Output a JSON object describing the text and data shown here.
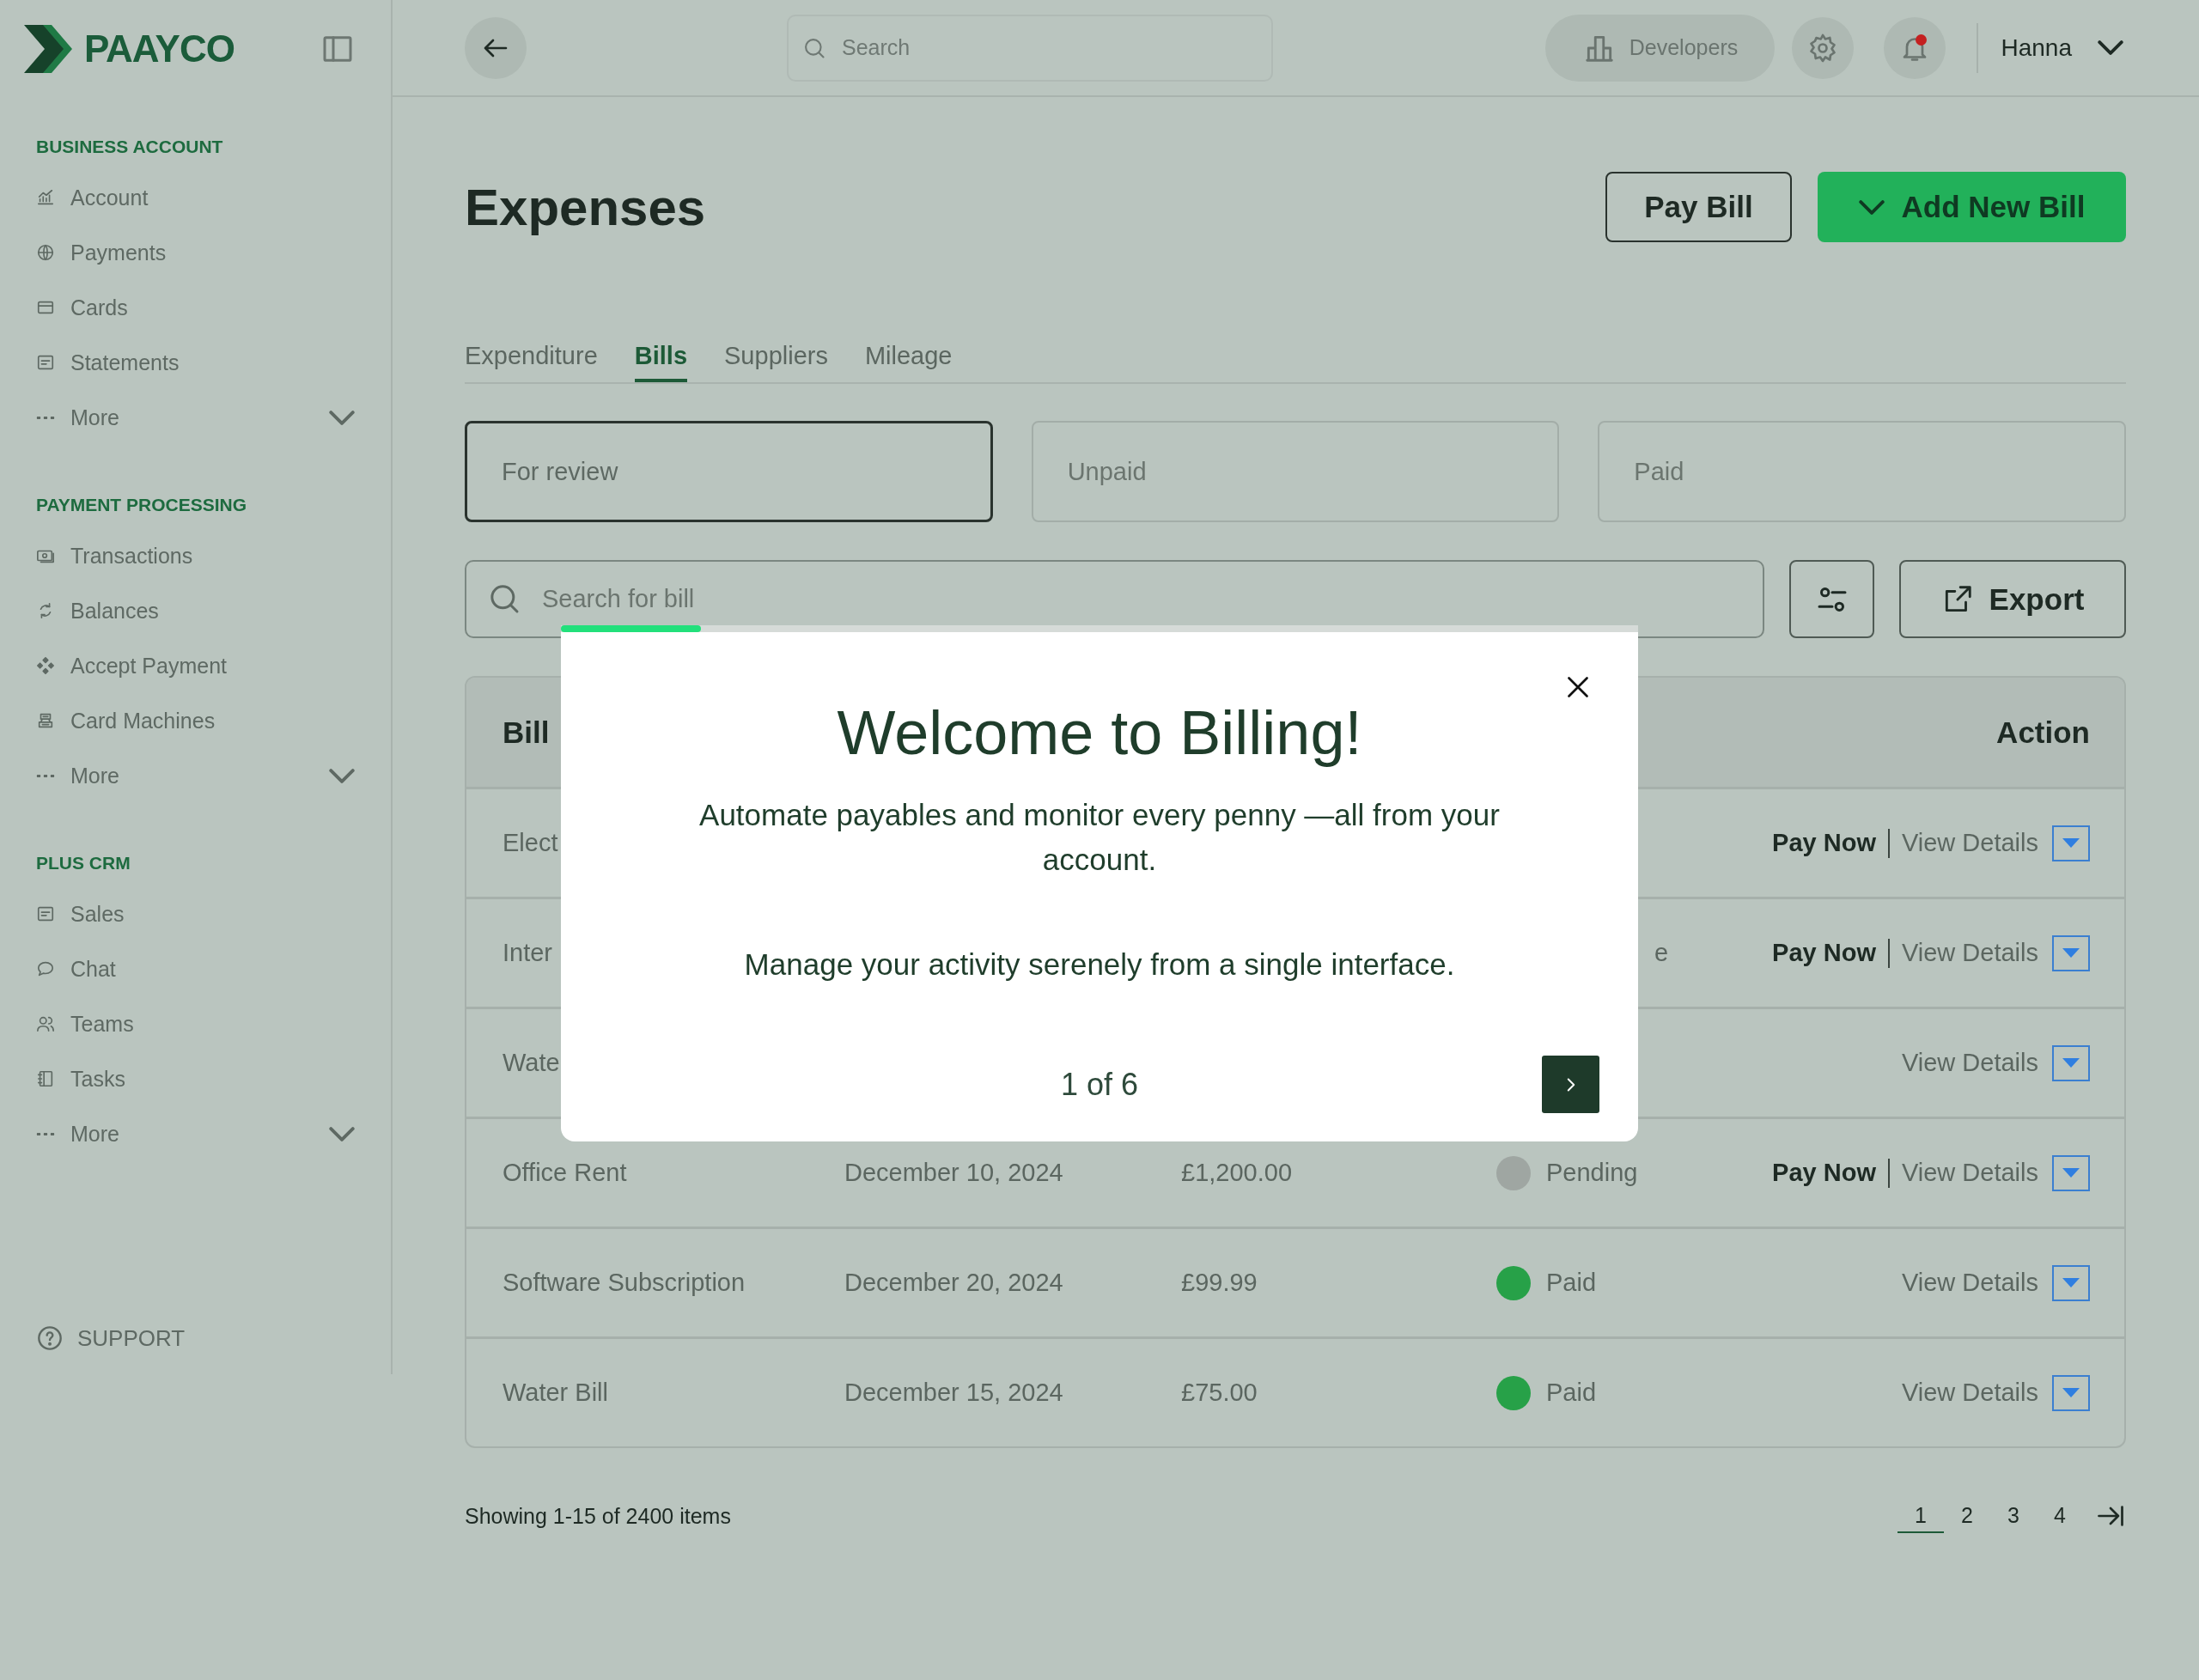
{
  "brand": {
    "name": "PAAYCO"
  },
  "sidebar": {
    "sections": [
      {
        "title": "BUSINESS ACCOUNT",
        "items": [
          {
            "label": "Account",
            "kind": "link"
          },
          {
            "label": "Payments",
            "kind": "link"
          },
          {
            "label": "Cards",
            "kind": "link"
          },
          {
            "label": "Statements",
            "kind": "link"
          },
          {
            "label": "More",
            "kind": "more"
          }
        ]
      },
      {
        "title": "PAYMENT PROCESSING",
        "items": [
          {
            "label": "Transactions",
            "kind": "link"
          },
          {
            "label": "Balances",
            "kind": "link"
          },
          {
            "label": "Accept Payment",
            "kind": "link"
          },
          {
            "label": "Card Machines",
            "kind": "link"
          },
          {
            "label": "More",
            "kind": "more"
          }
        ]
      },
      {
        "title": "PLUS CRM",
        "items": [
          {
            "label": "Sales",
            "kind": "link"
          },
          {
            "label": "Chat",
            "kind": "link"
          },
          {
            "label": "Teams",
            "kind": "link"
          },
          {
            "label": "Tasks",
            "kind": "link"
          },
          {
            "label": "More",
            "kind": "more"
          }
        ]
      }
    ],
    "support": "SUPPORT"
  },
  "topbar": {
    "search": {
      "placeholder": "Search"
    },
    "developers": "Developers",
    "notification": {
      "has_unread": true
    },
    "user": "Hanna"
  },
  "page": {
    "title": "Expenses",
    "buttons": [
      {
        "label": "Pay Bill",
        "kind": "outline"
      },
      {
        "label": "Add New Bill",
        "kind": "primary"
      }
    ]
  },
  "tabs": [
    {
      "label": "Expenditure",
      "selected": false
    },
    {
      "label": "Bills",
      "selected": true
    },
    {
      "label": "Suppliers",
      "selected": false
    },
    {
      "label": "Mileage",
      "selected": false
    }
  ],
  "filters": [
    {
      "label": "For review",
      "selected": true
    },
    {
      "label": "Unpaid",
      "selected": false
    },
    {
      "label": "Paid",
      "selected": false
    }
  ],
  "bill_search": {
    "placeholder": "Search for bill"
  },
  "export": "Export",
  "table": {
    "columns": [
      "Bill",
      "Action"
    ],
    "rows": [
      {
        "name": "Elect",
        "pay_now": "Pay Now",
        "view": "View Details"
      },
      {
        "name": "Inter",
        "status_tail": "e",
        "pay_now": "Pay Now",
        "view": "View Details"
      },
      {
        "name": "Wate",
        "view": "View Details"
      },
      {
        "name": "Office Rent",
        "date": "December 10, 2024",
        "amount": "£1,200.00",
        "status": {
          "label": "Pending",
          "color": "#9fa6a2"
        },
        "pay_now": "Pay Now",
        "view": "View Details"
      },
      {
        "name": "Software Subscription",
        "date": "December 20, 2024",
        "amount": "£99.99",
        "status": {
          "label": "Paid",
          "color": "#27a148"
        },
        "view": "View Details"
      },
      {
        "name": "Water Bill",
        "date": "December 15, 2024",
        "amount": "£75.00",
        "status": {
          "label": "Paid",
          "color": "#27a148"
        },
        "view": "View Details"
      }
    ]
  },
  "footer": {
    "summary": "Showing 1-15 of 2400 items",
    "pages": [
      {
        "label": "1",
        "selected": true
      },
      {
        "label": "2",
        "selected": false
      },
      {
        "label": "3",
        "selected": false
      },
      {
        "label": "4",
        "selected": false
      }
    ]
  },
  "modal": {
    "progress": {
      "level": 0.13
    },
    "title": "Welcome to Billing!",
    "description": "Automate payables and monitor every penny —all from your account.",
    "body": "Manage your activity serenely from a single interface.",
    "counter": "1 of 6"
  }
}
